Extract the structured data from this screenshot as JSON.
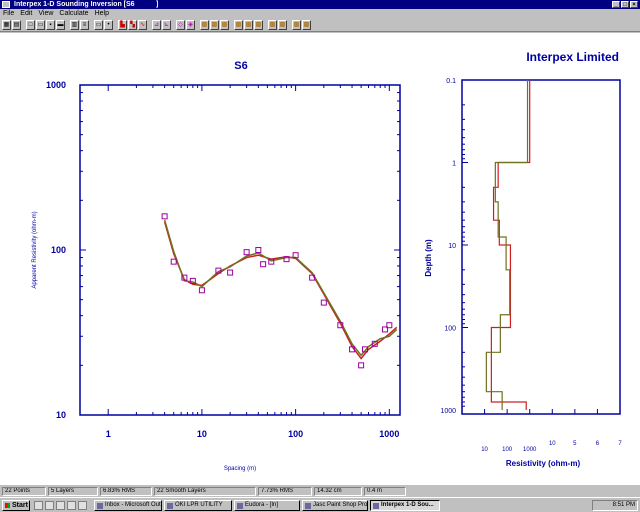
{
  "window": {
    "title": "Interpex 1-D Sounding Inversion [S6",
    "title_suffix": "]"
  },
  "menu": [
    "File",
    "Edit",
    "View",
    "Calculate",
    "Help"
  ],
  "header": {
    "company": "Interpex Limited"
  },
  "chart_data": [
    {
      "type": "scatter",
      "title": "S6",
      "xlabel": "Spacing (m)",
      "ylabel": "Apparent Resistivity (ohm-m)",
      "xscale": "log",
      "yscale": "log",
      "xlim": [
        0.5,
        1300
      ],
      "ylim": [
        10,
        1000
      ],
      "xticks": [
        "1",
        "10",
        "100",
        "1000"
      ],
      "yticks": [
        "10",
        "100",
        "1000"
      ],
      "points": [
        [
          4,
          160
        ],
        [
          5,
          85
        ],
        [
          6.5,
          68
        ],
        [
          8,
          65
        ],
        [
          10,
          57
        ],
        [
          15,
          75
        ],
        [
          20,
          73
        ],
        [
          30,
          97
        ],
        [
          40,
          100
        ],
        [
          45,
          82
        ],
        [
          55,
          85
        ],
        [
          80,
          88
        ],
        [
          100,
          93
        ],
        [
          150,
          68
        ],
        [
          200,
          48
        ],
        [
          300,
          35
        ],
        [
          400,
          25
        ],
        [
          500,
          20
        ],
        [
          550,
          25
        ],
        [
          700,
          27
        ],
        [
          900,
          33
        ],
        [
          1000,
          35
        ]
      ],
      "series": [
        {
          "color": "#cc2020",
          "values": [
            [
              4,
              148
            ],
            [
              5,
              95
            ],
            [
              6.5,
              66
            ],
            [
              8,
              62
            ],
            [
              10,
              61
            ],
            [
              15,
              72
            ],
            [
              20,
              80
            ],
            [
              30,
              90
            ],
            [
              40,
              93
            ],
            [
              55,
              88
            ],
            [
              80,
              91
            ],
            [
              100,
              89
            ],
            [
              150,
              72
            ],
            [
              200,
              54
            ],
            [
              300,
              36
            ],
            [
              400,
              26
            ],
            [
              500,
              22
            ],
            [
              600,
              25
            ],
            [
              800,
              28
            ],
            [
              1000,
              31
            ],
            [
              1200,
              34
            ]
          ]
        },
        {
          "color": "#707020",
          "values": [
            [
              4,
              152
            ],
            [
              5,
              98
            ],
            [
              6.5,
              65
            ],
            [
              8,
              64
            ],
            [
              10,
              60
            ],
            [
              15,
              74
            ],
            [
              20,
              79
            ],
            [
              30,
              92
            ],
            [
              40,
              96
            ],
            [
              55,
              86
            ],
            [
              80,
              90
            ],
            [
              100,
              90
            ],
            [
              150,
              73
            ],
            [
              200,
              55
            ],
            [
              300,
              37
            ],
            [
              400,
              27
            ],
            [
              500,
              23
            ],
            [
              600,
              26
            ],
            [
              800,
              29
            ],
            [
              1000,
              30
            ],
            [
              1200,
              33
            ]
          ]
        }
      ]
    },
    {
      "type": "line",
      "xlabel": "Resistivity (ohm-m)",
      "ylabel": "Depth (m)",
      "xscale": "log",
      "yscale": "log",
      "xlim": [
        1,
        10000000
      ],
      "ylim": [
        0.1,
        1000
      ],
      "xticks": [
        "10",
        "100",
        "1000",
        "10",
        "5",
        "6",
        "7"
      ],
      "yticks": [
        "0.1",
        "1",
        "10",
        "100",
        "1000"
      ],
      "series": [
        {
          "color": "#cc2020",
          "values": [
            [
              1000,
              0.1
            ],
            [
              1000,
              1
            ],
            [
              40,
              1
            ],
            [
              40,
              2
            ],
            [
              25,
              2
            ],
            [
              25,
              5
            ],
            [
              45,
              5
            ],
            [
              45,
              10
            ],
            [
              140,
              10
            ],
            [
              140,
              100
            ],
            [
              20,
              100
            ],
            [
              20,
              800
            ],
            [
              700,
              800
            ],
            [
              700,
              1000
            ]
          ]
        },
        {
          "color": "#707020",
          "values": [
            [
              800,
              0.1
            ],
            [
              800,
              1
            ],
            [
              30,
              1
            ],
            [
              30,
              3
            ],
            [
              40,
              3
            ],
            [
              40,
              8
            ],
            [
              90,
              8
            ],
            [
              90,
              20
            ],
            [
              130,
              20
            ],
            [
              130,
              70
            ],
            [
              50,
              70
            ],
            [
              50,
              200
            ],
            [
              12,
              200
            ],
            [
              12,
              600
            ],
            [
              60,
              600
            ],
            [
              60,
              1000
            ]
          ]
        }
      ]
    }
  ],
  "status": [
    "22 Points",
    "5 Layers",
    "6.83% RMS",
    "22 Smooth Layers",
    "7.73% RMS",
    "14.32 cm",
    "0.4 m"
  ],
  "taskbar": {
    "start": "Start",
    "tasks": [
      "Inbox - Microsoft Out...",
      "OKI LPR UTILITY",
      "Eudora - [In]",
      "Jasc Paint Shop Pro",
      "Interpex 1-D Sou..."
    ],
    "clock": "8:51 PM"
  }
}
